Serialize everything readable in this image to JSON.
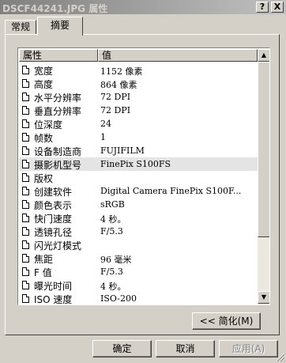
{
  "window": {
    "title": "DSCF44241.JPG 属性",
    "help_label": "?",
    "close_label": "X"
  },
  "tabs": [
    {
      "label": "常规"
    },
    {
      "label": "摘要"
    }
  ],
  "list": {
    "headers": {
      "property": "属性",
      "value": "值"
    },
    "rows": [
      {
        "name": "宽度",
        "value": "1152 像素"
      },
      {
        "name": "高度",
        "value": "864 像素"
      },
      {
        "name": "水平分辨率",
        "value": "72 DPI"
      },
      {
        "name": "垂直分辨率",
        "value": "72 DPI"
      },
      {
        "name": "位深度",
        "value": "24"
      },
      {
        "name": "帧数",
        "value": "1"
      },
      {
        "name": "设备制造商",
        "value": "FUJIFILM"
      },
      {
        "name": "摄影机型号",
        "value": "FinePix S100FS"
      },
      {
        "name": "版权",
        "value": ""
      },
      {
        "name": "创建软件",
        "value": "Digital Camera FinePix S100F..."
      },
      {
        "name": "颜色表示",
        "value": "sRGB"
      },
      {
        "name": "快门速度",
        "value": "4 秒。"
      },
      {
        "name": "透镜孔径",
        "value": "F/5.3"
      },
      {
        "name": "闪光灯模式",
        "value": ""
      },
      {
        "name": "焦距",
        "value": "96 毫米"
      },
      {
        "name": "F 值",
        "value": "F/5.3"
      },
      {
        "name": "曝光时间",
        "value": "4 秒。"
      },
      {
        "name": "ISO 速度",
        "value": "ISO-200"
      }
    ],
    "selected_index": 7
  },
  "buttons": {
    "simplify": "<< 简化(M)",
    "ok": "确定",
    "cancel": "取消",
    "apply": "应用(A)"
  },
  "colors": {
    "face": "#d4d0c8",
    "selection": "#e4e4e4"
  }
}
